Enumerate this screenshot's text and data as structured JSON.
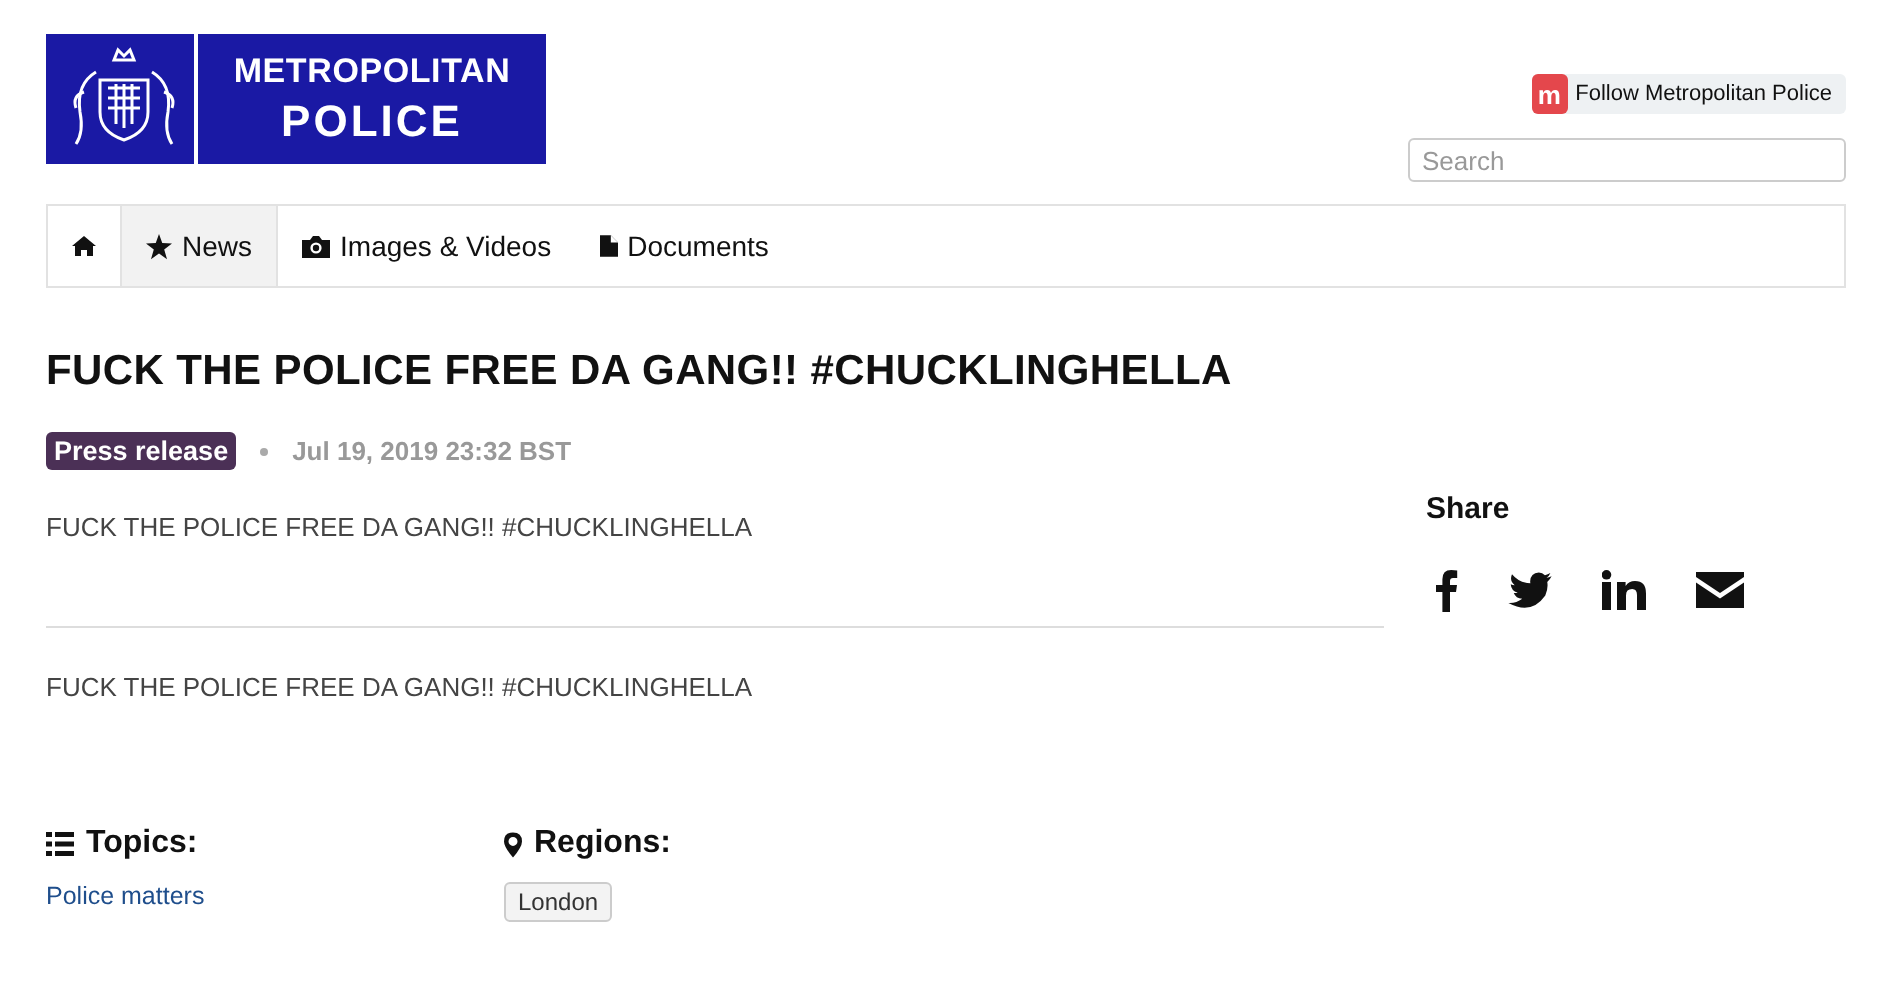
{
  "logo": {
    "line1": "METROPOLITAN",
    "line2": "POLICE"
  },
  "follow": {
    "badge": "m",
    "label": "Follow Metropolitan Police"
  },
  "search": {
    "placeholder": "Search"
  },
  "nav": [
    {
      "kind": "home",
      "selected": false
    },
    {
      "kind": "star",
      "label": "News",
      "selected": true
    },
    {
      "kind": "camera",
      "label": "Images & Videos",
      "selected": false
    },
    {
      "kind": "file",
      "label": "Documents",
      "selected": false
    }
  ],
  "article": {
    "title": "FUCK THE POLICE FREE DA GANG!! #CHUCKLINGHELLA",
    "tag": "Press release",
    "date": "Jul 19, 2019 23:32 BST",
    "summary": "FUCK THE POLICE FREE DA GANG!! #CHUCKLINGHELLA",
    "body": "FUCK THE POLICE FREE DA GANG!! #CHUCKLINGHELLA"
  },
  "share": {
    "title": "Share",
    "items": [
      {
        "kind": "facebook"
      },
      {
        "kind": "twitter"
      },
      {
        "kind": "linkedin"
      },
      {
        "kind": "email"
      }
    ]
  },
  "topics": {
    "title": "Topics:",
    "items": [
      "Police matters"
    ]
  },
  "regions": {
    "title": "Regions:",
    "items": [
      "London"
    ]
  }
}
